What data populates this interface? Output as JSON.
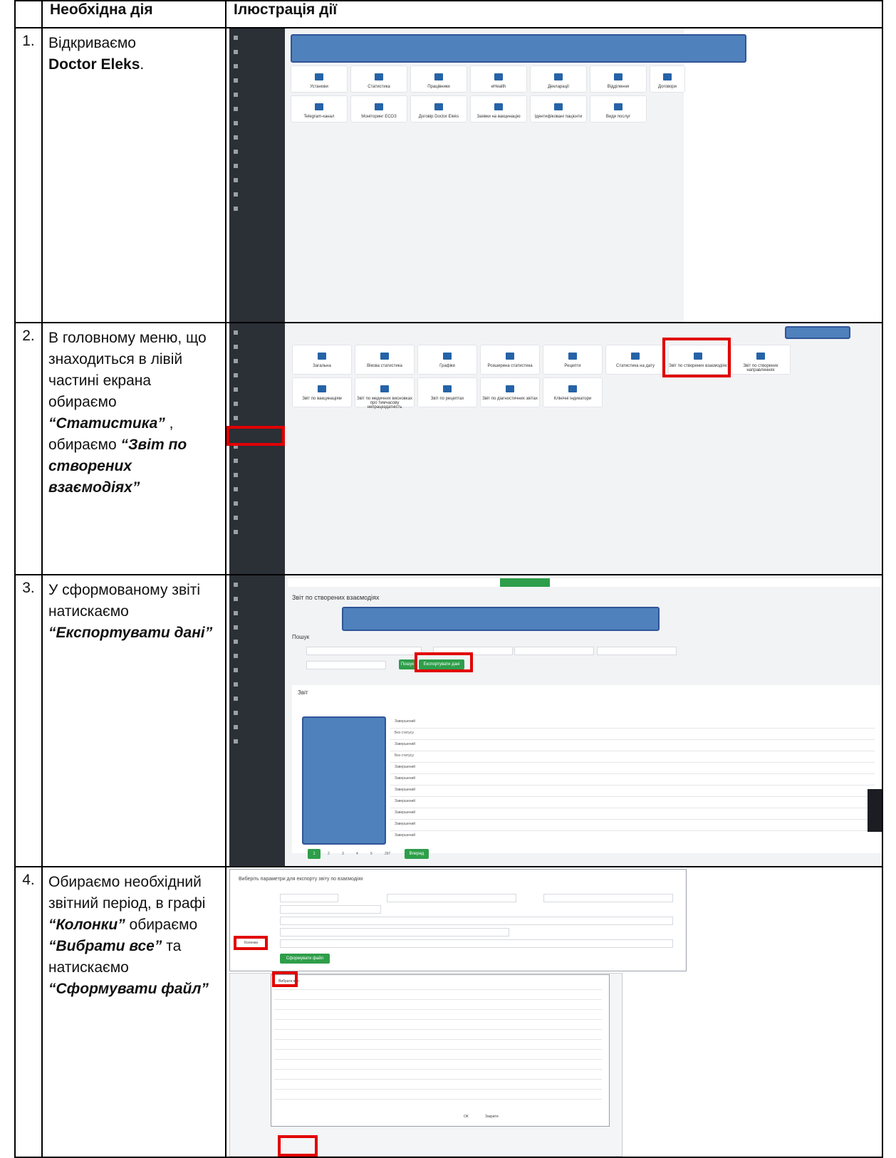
{
  "header": {
    "col_action": "Необхідна дія",
    "col_illustration": "Ілюстрація дії"
  },
  "steps": [
    {
      "num": "1.",
      "text_a": "Відкриваємо",
      "text_b": "Doctor Eleks",
      "text_c": "."
    },
    {
      "num": "2.",
      "text_a": "В головному меню, що знаходиться в лівій частині екрана обираємо ",
      "text_b": "“Статистика”",
      "text_c": " , обираємо ",
      "text_d": "“Звіт по створених взаємодіях”"
    },
    {
      "num": "3.",
      "text_a": "У сформованому звіті натискаємо ",
      "text_b": "“Експортувати дані”"
    },
    {
      "num": "4.",
      "text_a": "Обираємо необхідний звітний період, в графі ",
      "text_b": "“Колонки”",
      "text_c": " обираємо ",
      "text_d": "“Вибрати все”",
      "text_e": " та натискаємо ",
      "text_f": "“Сформувати файл”"
    }
  ],
  "shot1": {
    "tiles_row1": [
      "Установи",
      "Статистика",
      "Працівники",
      "eHealth",
      "Декларації",
      "Відділення",
      "Договори"
    ],
    "tiles_row2": [
      "Telegram-канал",
      "Моніторинг ЕСОЗ",
      "Договір Doctor Eleks",
      "Заявки на вакцинацію",
      "Ідентифіковані пацієнти",
      "Види послуг"
    ]
  },
  "shot2": {
    "tiles_row1": [
      "Загальна",
      "Вікова статистика",
      "Графіки",
      "Розширена статистика",
      "Рецепти",
      "Статистика на дату",
      "Звіт по створених взаємодіях",
      "Звіт по створених направленнях"
    ],
    "tiles_row2": [
      "Звіт по вакцинаціям",
      "Звіт по медичних висновках про тимчасову непрацездатність",
      "Звіт по рецептах",
      "Звіт по діагностичних звітах",
      "Клінічні індикатори"
    ],
    "sidebar_active": "Статистика"
  },
  "shot3": {
    "title": "Звіт по створених взаємодіях",
    "search": "Пошук",
    "btn_search": "Пошук",
    "btn_export": "Експортувати дані",
    "report": "Звіт",
    "statuses": [
      "Завершений",
      "Без статусу",
      "Завершений",
      "Без статусу",
      "Завершений",
      "Завершений",
      "Завершений",
      "Завершений",
      "Завершений",
      "Завершений",
      "Завершений"
    ],
    "pages": [
      "1",
      "2",
      "3",
      "4",
      "5",
      "297"
    ],
    "btn_next": "Вперед"
  },
  "shot4": {
    "modal_title": "Виберіть параметри для експорту звіту по взаємодіях",
    "label_columns": "Колонки",
    "btn_form": "Сформувати файл",
    "select_all": "Вибрати все",
    "btn_ok": "ОК",
    "btn_cancel": "Закрити"
  }
}
